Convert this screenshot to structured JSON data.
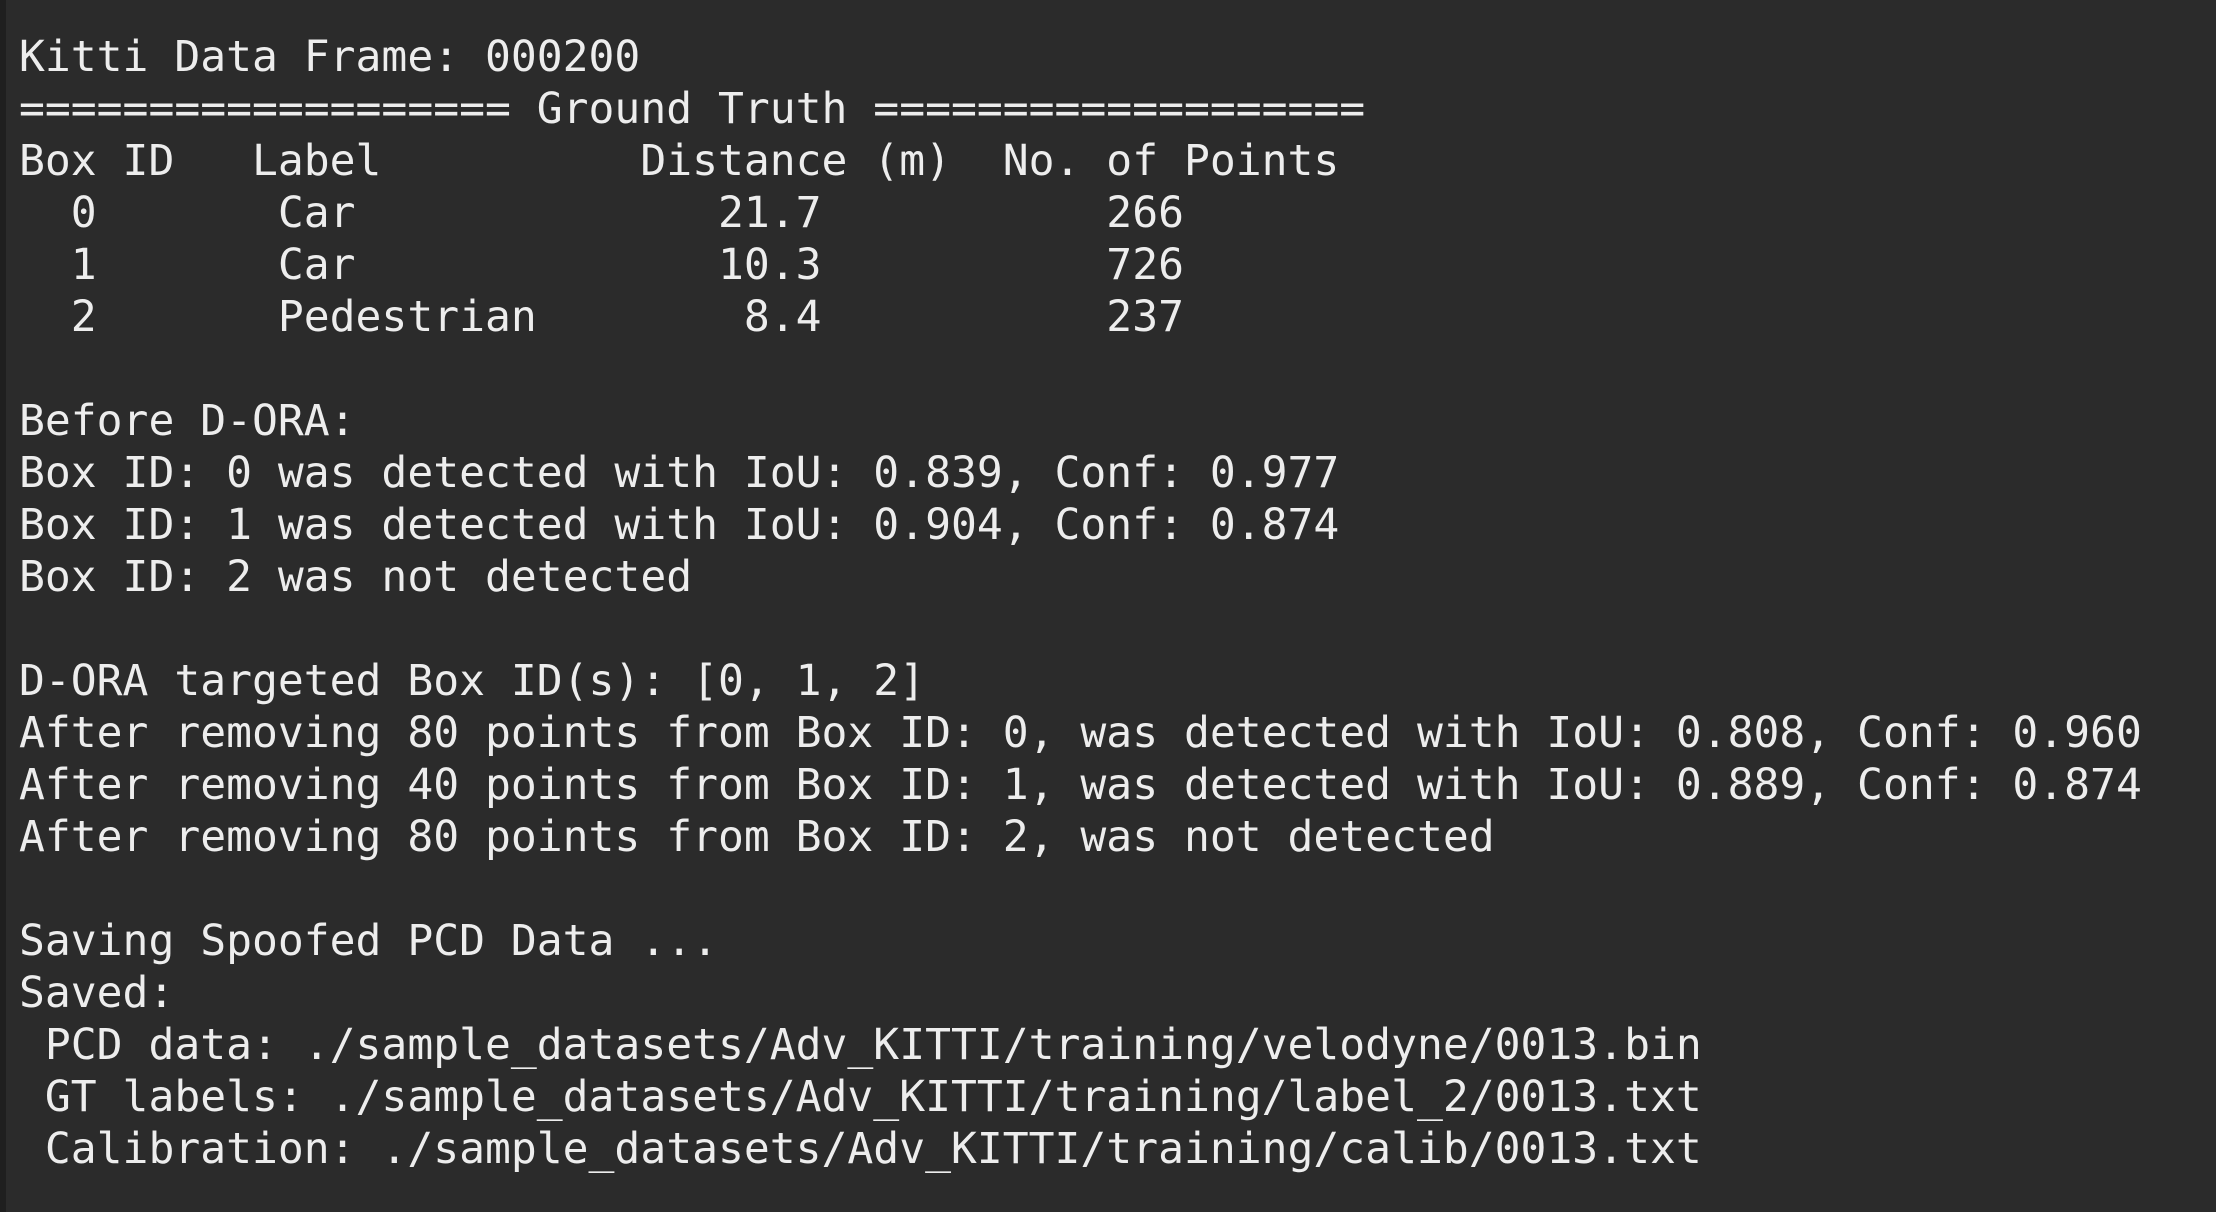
{
  "terminal": {
    "lines": [
      "Kitti Data Frame: 000200",
      "=================== Ground Truth ===================",
      "Box ID   Label          Distance (m)  No. of Points",
      "  0       Car              21.7           266",
      "  1       Car              10.3           726",
      "  2       Pedestrian        8.4           237",
      "",
      "Before D-ORA:",
      "Box ID: 0 was detected with IoU: 0.839, Conf: 0.977",
      "Box ID: 1 was detected with IoU: 0.904, Conf: 0.874",
      "Box ID: 2 was not detected",
      "",
      "D-ORA targeted Box ID(s): [0, 1, 2]",
      "After removing 80 points from Box ID: 0, was detected with IoU: 0.808, Conf: 0.960",
      "After removing 40 points from Box ID: 1, was detected with IoU: 0.889, Conf: 0.874",
      "After removing 80 points from Box ID: 2, was not detected",
      "",
      "Saving Spoofed PCD Data ...",
      "Saved:",
      " PCD data: ./sample_datasets/Adv_KITTI/training/velodyne/0013.bin",
      " GT labels: ./sample_datasets/Adv_KITTI/training/label_2/0013.txt",
      " Calibration: ./sample_datasets/Adv_KITTI/training/calib/0013.txt"
    ]
  }
}
